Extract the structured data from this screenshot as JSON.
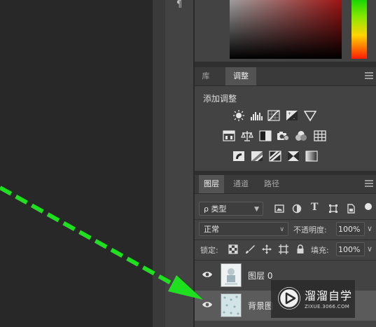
{
  "adjustments_panel": {
    "tabs": [
      {
        "label": "库"
      },
      {
        "label": "调整"
      }
    ],
    "title": "添加调整",
    "icon_rows": [
      [
        "brightness-contrast-icon",
        "levels-icon",
        "curves-icon",
        "exposure-icon",
        "vibrance-icon"
      ],
      [
        "hue-saturation-icon",
        "color-balance-icon",
        "black-white-icon",
        "photo-filter-icon",
        "channel-mixer-icon",
        "color-lookup-icon"
      ],
      [
        "invert-icon",
        "posterize-icon",
        "threshold-icon",
        "selective-color-icon",
        "gradient-map-icon"
      ]
    ]
  },
  "layers_panel": {
    "tabs": [
      {
        "label": "图层"
      },
      {
        "label": "通道"
      },
      {
        "label": "路径"
      }
    ],
    "filter_kind": "ρ 类型",
    "blend_mode": "正常",
    "opacity_label": "不透明度:",
    "opacity_value": "100%",
    "lock_label": "锁定:",
    "fill_label": "填充:",
    "fill_value": "100%",
    "layers": [
      {
        "name": "图层 0",
        "selected": false
      },
      {
        "name": "背景图",
        "selected": true
      }
    ]
  },
  "watermark": {
    "title": "溜溜自学",
    "subtitle": "ZIXUE.3066.COM"
  },
  "colors": {
    "arrow": "#1fe01f",
    "panel_bg": "#434343",
    "canvas_bg": "#282828",
    "selected_row": "#5b5b5b"
  }
}
